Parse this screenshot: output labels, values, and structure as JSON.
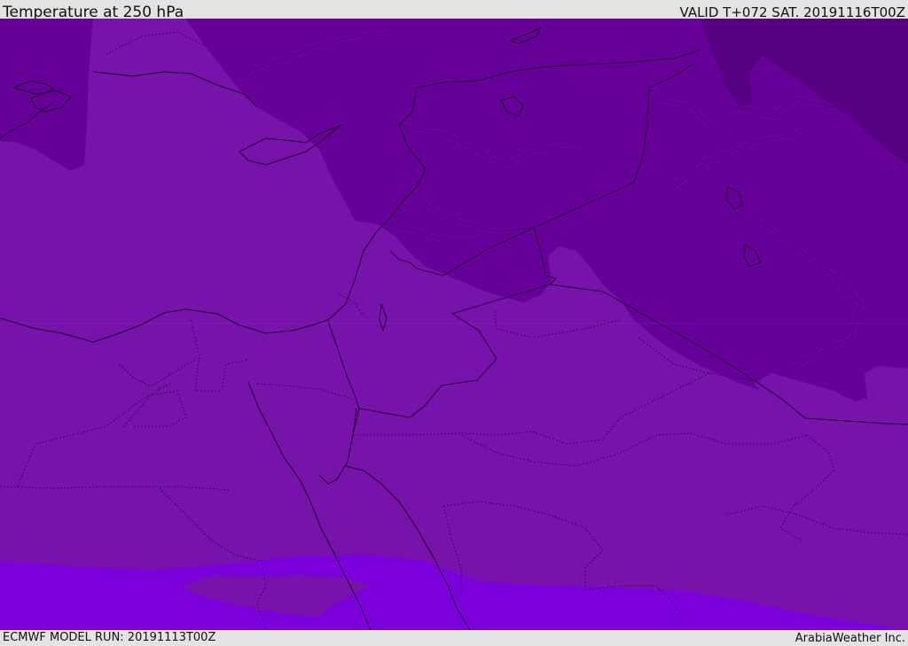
{
  "header": {
    "title": "Temperature at 250 hPa",
    "valid": "VALID T+072 SAT. 20191116T00Z"
  },
  "footer": {
    "model_run": "ECMWF MODEL RUN: 20191113T00Z",
    "credit": "ArabiaWeather Inc."
  },
  "colors": {
    "band_darkest": "#540080",
    "band_dark": "#660099",
    "band_medium": "#7713ab",
    "band_light": "#7b00dc",
    "boundary_line": "#1a0028",
    "background_bar": "#e3e3e3"
  }
}
